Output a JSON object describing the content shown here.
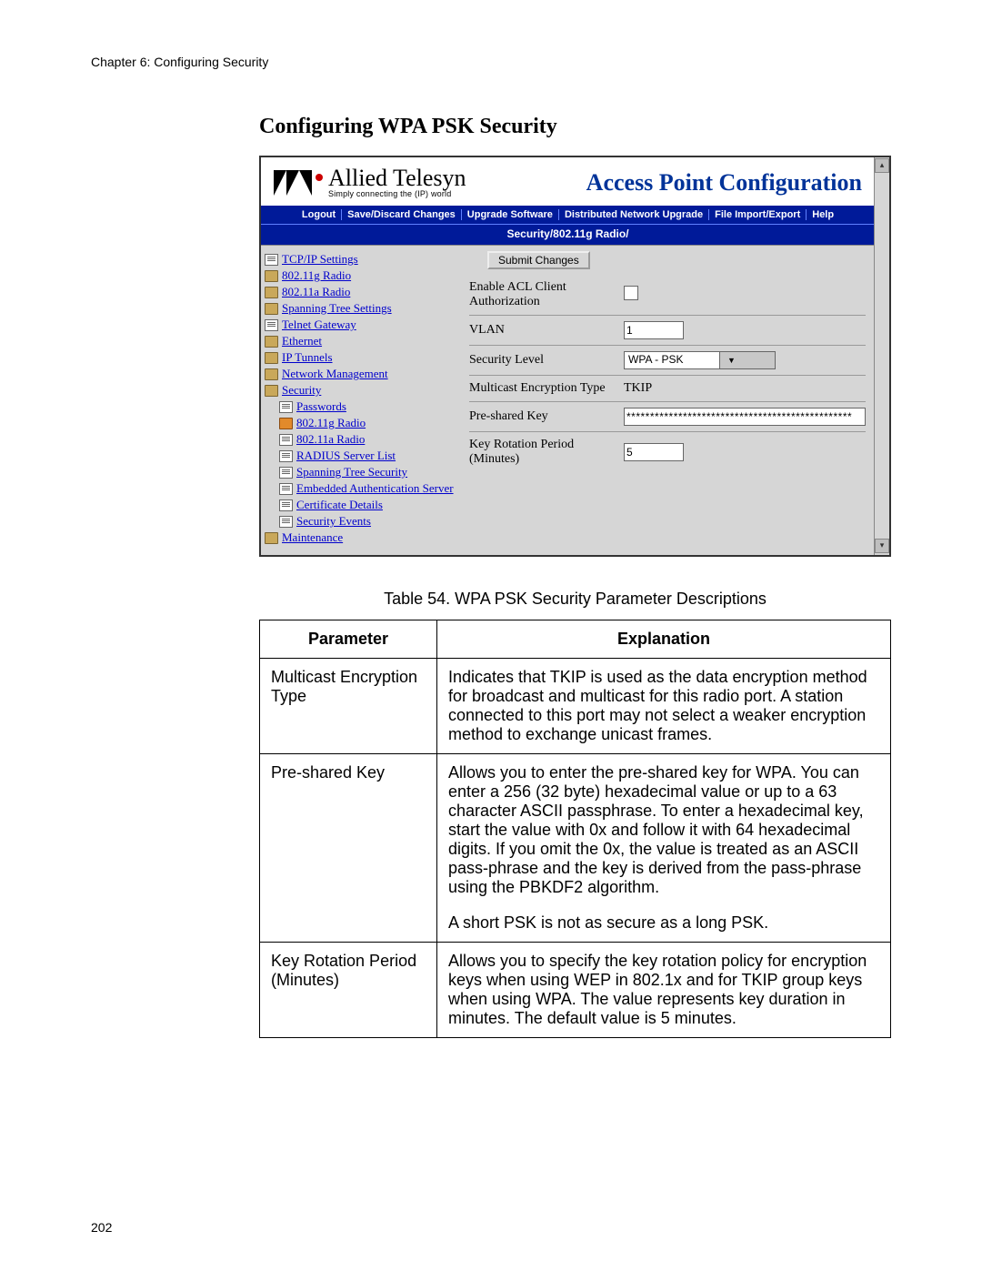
{
  "chapter_header": "Chapter 6: Configuring Security",
  "section_title": "Configuring WPA PSK Security",
  "page_number": "202",
  "banner": {
    "brand": "Allied Telesyn",
    "tagline": "Simply connecting the (IP) world",
    "title": "Access Point Configuration"
  },
  "menubar": {
    "items": [
      "Logout",
      "Save/Discard Changes",
      "Upgrade Software",
      "Distributed Network Upgrade",
      "File Import/Export",
      "Help"
    ]
  },
  "breadcrumb": "Security/802.11g Radio/",
  "nav": [
    {
      "icon": "page",
      "label": "TCP/IP Settings",
      "indent": 0
    },
    {
      "icon": "folder",
      "label": "802.11g Radio",
      "indent": 0
    },
    {
      "icon": "folder",
      "label": "802.11a Radio",
      "indent": 0
    },
    {
      "icon": "folder",
      "label": "Spanning Tree Settings",
      "indent": 0
    },
    {
      "icon": "page",
      "label": "Telnet Gateway",
      "indent": 0
    },
    {
      "icon": "folder",
      "label": "Ethernet",
      "indent": 0
    },
    {
      "icon": "folder",
      "label": "IP Tunnels",
      "indent": 0
    },
    {
      "icon": "folder",
      "label": "Network Management",
      "indent": 0
    },
    {
      "icon": "folder",
      "label": "Security",
      "indent": 0
    },
    {
      "icon": "page",
      "label": "Passwords",
      "indent": 1
    },
    {
      "icon": "page-o",
      "label": "802.11g Radio",
      "indent": 1
    },
    {
      "icon": "page",
      "label": "802.11a Radio",
      "indent": 1
    },
    {
      "icon": "page",
      "label": "RADIUS Server List",
      "indent": 1
    },
    {
      "icon": "page",
      "label": "Spanning Tree Security",
      "indent": 1
    },
    {
      "icon": "page",
      "label": "Embedded Authentication Server",
      "indent": 1
    },
    {
      "icon": "page",
      "label": "Certificate Details",
      "indent": 1
    },
    {
      "icon": "page",
      "label": "Security Events",
      "indent": 1
    },
    {
      "icon": "folder",
      "label": "Maintenance",
      "indent": 0
    }
  ],
  "form": {
    "submit_label": "Submit Changes",
    "rows": {
      "acl": {
        "label": "Enable ACL Client Authorization"
      },
      "vlan": {
        "label": "VLAN",
        "value": "1"
      },
      "sec": {
        "label": "Security Level",
        "value": "WPA - PSK"
      },
      "mcast": {
        "label": "Multicast Encryption Type",
        "value": "TKIP"
      },
      "psk": {
        "label": "Pre-shared Key",
        "value": "************************************************"
      },
      "rot": {
        "label": "Key Rotation Period (Minutes)",
        "value": "5"
      }
    }
  },
  "table": {
    "caption": "Table 54. WPA PSK Security Parameter Descriptions",
    "head": {
      "param": "Parameter",
      "expl": "Explanation"
    },
    "rows": [
      {
        "param": "Multicast Encryption Type",
        "expl": "Indicates that TKIP is used as the data encryption method for broadcast and multicast for this radio port. A station connected to this port may not select a weaker encryption method to exchange unicast frames."
      },
      {
        "param": "Pre-shared Key",
        "expl": "Allows you to enter the pre-shared key for WPA. You can enter a 256 (32 byte) hexadecimal value or up to a 63 character ASCII passphrase. To enter a hexadecimal key, start the value with 0x and follow it with 64 hexadecimal digits. If you omit the 0x, the value is treated as an ASCII pass-phrase and the key is derived from the pass-phrase using the PBKDF2 algorithm.",
        "expl2": "A short PSK is not as secure as a long PSK."
      },
      {
        "param": "Key Rotation Period (Minutes)",
        "expl": "Allows you to specify the key rotation policy for encryption keys when using WEP in 802.1x and for TKIP group keys when using WPA. The value represents key duration in minutes. The default value is 5 minutes."
      }
    ]
  }
}
